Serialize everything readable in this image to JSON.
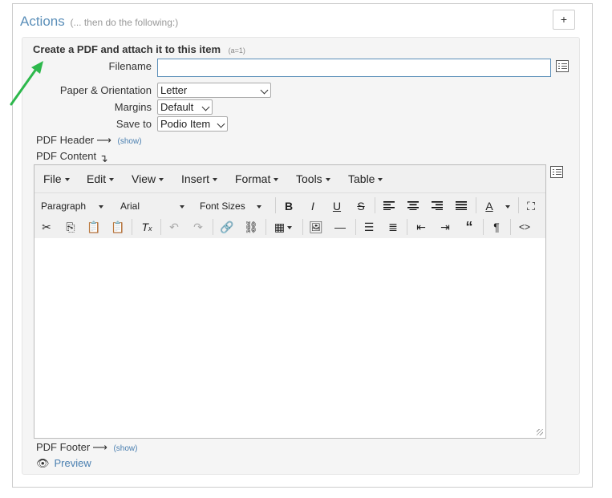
{
  "actions": {
    "title": "Actions",
    "subtitle": "(... then do the following:)",
    "add_label": "+"
  },
  "panel": {
    "title": "Create a PDF and attach it to this item",
    "tag": "(a=1)"
  },
  "form": {
    "filename_label": "Filename",
    "filename_value": "",
    "paper_label": "Paper & Orientation",
    "paper_value": "Letter",
    "margins_label": "Margins",
    "margins_value": "Default",
    "saveto_label": "Save to",
    "saveto_value": "Podio Item"
  },
  "sections": {
    "header_label": "PDF Header",
    "header_link": "(show)",
    "content_label": "PDF Content",
    "footer_label": "PDF Footer",
    "footer_link": "(show)"
  },
  "editor": {
    "menus": [
      "File",
      "Edit",
      "View",
      "Insert",
      "Format",
      "Tools",
      "Table"
    ],
    "block_format": "Paragraph",
    "font_family": "Arial",
    "font_size": "Font Sizes"
  },
  "preview_label": "Preview",
  "colors": {
    "link": "#4a7fb0",
    "title": "#5b8fb9",
    "arrow": "#2db84c"
  }
}
